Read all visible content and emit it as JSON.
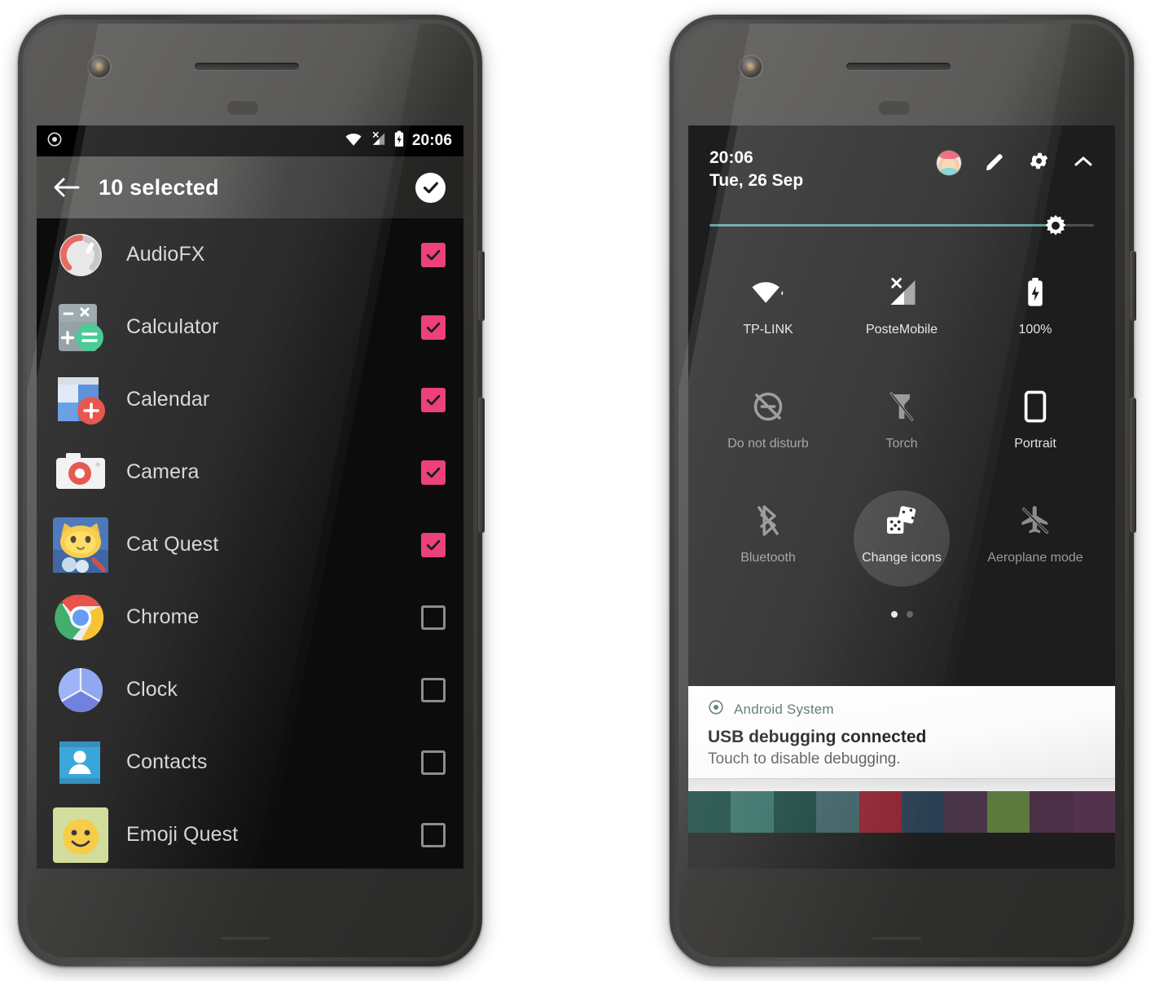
{
  "accent": "#ec417a",
  "left_phone": {
    "status_bar": {
      "time": "20:06",
      "icons": [
        "record-dot-icon",
        "wifi-icon",
        "cell-signal-off-icon",
        "battery-icon"
      ]
    },
    "app_bar": {
      "back_label": "back-arrow-icon",
      "title": "10 selected",
      "confirm_label": "confirm-check-icon"
    },
    "apps": [
      {
        "name": "AudioFX",
        "icon": "audiofx-icon",
        "checked": true
      },
      {
        "name": "Calculator",
        "icon": "calculator-icon",
        "checked": true
      },
      {
        "name": "Calendar",
        "icon": "calendar-icon",
        "checked": true
      },
      {
        "name": "Camera",
        "icon": "camera-icon",
        "checked": true
      },
      {
        "name": "Cat Quest",
        "icon": "cat-quest-icon",
        "checked": true
      },
      {
        "name": "Chrome",
        "icon": "chrome-icon",
        "checked": false
      },
      {
        "name": "Clock",
        "icon": "clock-icon",
        "checked": false
      },
      {
        "name": "Contacts",
        "icon": "contacts-icon",
        "checked": false
      },
      {
        "name": "Emoji Quest",
        "icon": "emoji-quest-icon",
        "checked": false
      }
    ]
  },
  "right_phone": {
    "quick_settings": {
      "time": "20:06",
      "date": "Tue, 26 Sep",
      "header_icons": [
        "avatar",
        "edit-pencil-icon",
        "settings-gear-icon",
        "collapse-chevron-icon"
      ],
      "brightness": {
        "value": 90,
        "track_color": "#5f9b9b"
      },
      "tiles": [
        {
          "label": "TP-LINK",
          "icon": "wifi-icon",
          "state": "on",
          "highlighted": false
        },
        {
          "label": "PosteMobile",
          "icon": "cell-signal-icon",
          "state": "on",
          "highlighted": false
        },
        {
          "label": "100%",
          "icon": "battery-charging-icon",
          "state": "on",
          "highlighted": false
        },
        {
          "label": "Do not disturb",
          "icon": "dnd-off-icon",
          "state": "off",
          "highlighted": false
        },
        {
          "label": "Torch",
          "icon": "torch-off-icon",
          "state": "off",
          "highlighted": false
        },
        {
          "label": "Portrait",
          "icon": "rotation-portrait-icon",
          "state": "on",
          "highlighted": false
        },
        {
          "label": "Bluetooth",
          "icon": "bluetooth-off-icon",
          "state": "off",
          "highlighted": false
        },
        {
          "label": "Change icons",
          "icon": "dice-icon",
          "state": "on",
          "highlighted": true
        },
        {
          "label": "Aeroplane mode",
          "icon": "airplane-off-icon",
          "state": "off",
          "highlighted": false
        }
      ],
      "pages": {
        "count": 2,
        "current": 1
      }
    },
    "notification": {
      "app_icon": "android-system-icon",
      "app_name": "Android System",
      "title": "USB debugging connected",
      "body": "Touch to disable debugging."
    }
  }
}
